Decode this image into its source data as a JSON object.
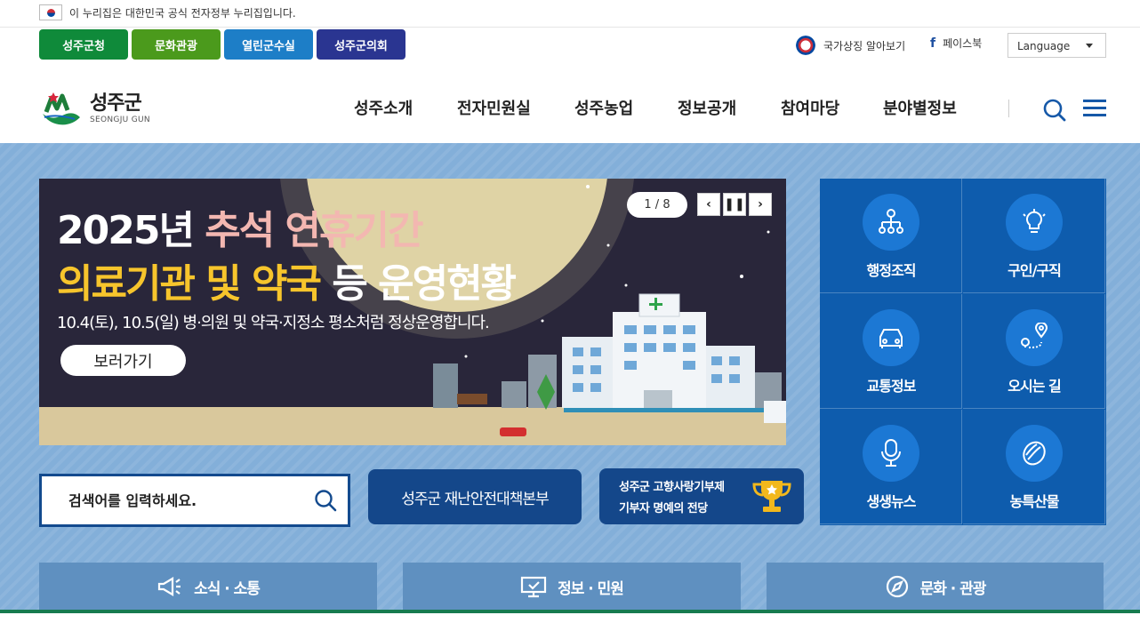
{
  "gov_banner": {
    "text": "이 누리집은 대한민국 공식 전자정부 누리집입니다."
  },
  "site_tabs": [
    "성주군청",
    "문화관광",
    "열린군수실",
    "성주군의회"
  ],
  "util": {
    "symbols": "국가상징 알아보기",
    "facebook": "페이스북",
    "language": "Language"
  },
  "logo": {
    "name": "성주군",
    "english": "SEONGJU GUN",
    "mark_text": "SEONGJU"
  },
  "gnb": [
    "성주소개",
    "전자민원실",
    "성주농업",
    "정보공개",
    "참여마당",
    "분야별정보"
  ],
  "banner": {
    "title1_a": "2025년 ",
    "title1_b": "추석 연휴기간",
    "title2_a": "의료기관 및 약국",
    "title2_b": " 등 운영현황",
    "subtitle": "10.4(토), 10.5(일) 병·의원 및 약국·지정소 평소처럼 정상운영합니다.",
    "button": "보러가기",
    "pager": "1 / 8",
    "prev": "‹",
    "pause": "❚❚",
    "next": "›"
  },
  "quick_menu": [
    {
      "label": "행정조직",
      "icon": "org-chart-icon"
    },
    {
      "label": "구인/구직",
      "icon": "lightbulb-icon"
    },
    {
      "label": "교통정보",
      "icon": "car-icon"
    },
    {
      "label": "오시는 길",
      "icon": "route-pin-icon"
    },
    {
      "label": "생생뉴스",
      "icon": "microphone-icon"
    },
    {
      "label": "농특산물",
      "icon": "melon-icon"
    }
  ],
  "search": {
    "placeholder": "검색어를 입력하세요."
  },
  "disaster": "성주군 재난안전대책본부",
  "hometown": {
    "line1": "성주군 고향사랑기부제",
    "line2": "기부자 명예의 전당"
  },
  "categories": [
    {
      "label": "소식 · 소통",
      "icon": "megaphone-icon"
    },
    {
      "label": "정보 · 민원",
      "icon": "monitor-check-icon"
    },
    {
      "label": "문화 · 관광",
      "icon": "compass-icon"
    }
  ],
  "colors": {
    "main_bg": "#83afd9",
    "quick_bg": "#0e5cad",
    "accent_green": "#177b4f",
    "navy": "#14478a"
  }
}
